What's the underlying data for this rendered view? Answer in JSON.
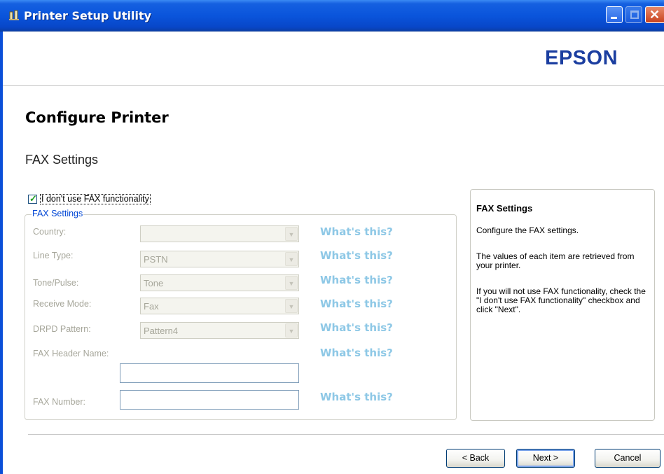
{
  "window": {
    "title": "Printer Setup Utility"
  },
  "header": {
    "logo": "EPSON"
  },
  "page": {
    "title": "Configure Printer",
    "section_title": "FAX Settings"
  },
  "no_fax": {
    "checked": true,
    "label": "I don't use FAX functionality"
  },
  "fax_group": {
    "legend": "FAX Settings",
    "country": {
      "label": "Country:",
      "value": "",
      "help": "What's this?"
    },
    "line_type": {
      "label": "Line Type:",
      "value": "PSTN",
      "help": "What's this?"
    },
    "tone_pulse": {
      "label": "Tone/Pulse:",
      "value": "Tone",
      "help": "What's this?"
    },
    "receive_mode": {
      "label": "Receive Mode:",
      "value": "Fax",
      "help": "What's this?"
    },
    "drpd_pattern": {
      "label": "DRPD Pattern:",
      "value": "Pattern4",
      "help": "What's this?"
    },
    "header_name": {
      "label": "FAX Header Name:",
      "value": "",
      "help": "What's this?"
    },
    "fax_number": {
      "label": "FAX Number:",
      "value": "",
      "help": "What's this?"
    }
  },
  "help_panel": {
    "title": "FAX Settings",
    "p1": "Configure the FAX settings.",
    "p2": "The values of each item are retrieved from your printer.",
    "p3": "If you will not use FAX functionality, check the \"I don't use FAX functionality\" checkbox and click \"Next\"."
  },
  "buttons": {
    "back": "< Back",
    "next": "Next >",
    "cancel": "Cancel"
  },
  "colors": {
    "titlebar": "#0a55dc",
    "logo": "#1b3ea0",
    "group_legend": "#0046d5",
    "disabled_text": "#a6a69a",
    "help_link": "#8ec8e6"
  }
}
